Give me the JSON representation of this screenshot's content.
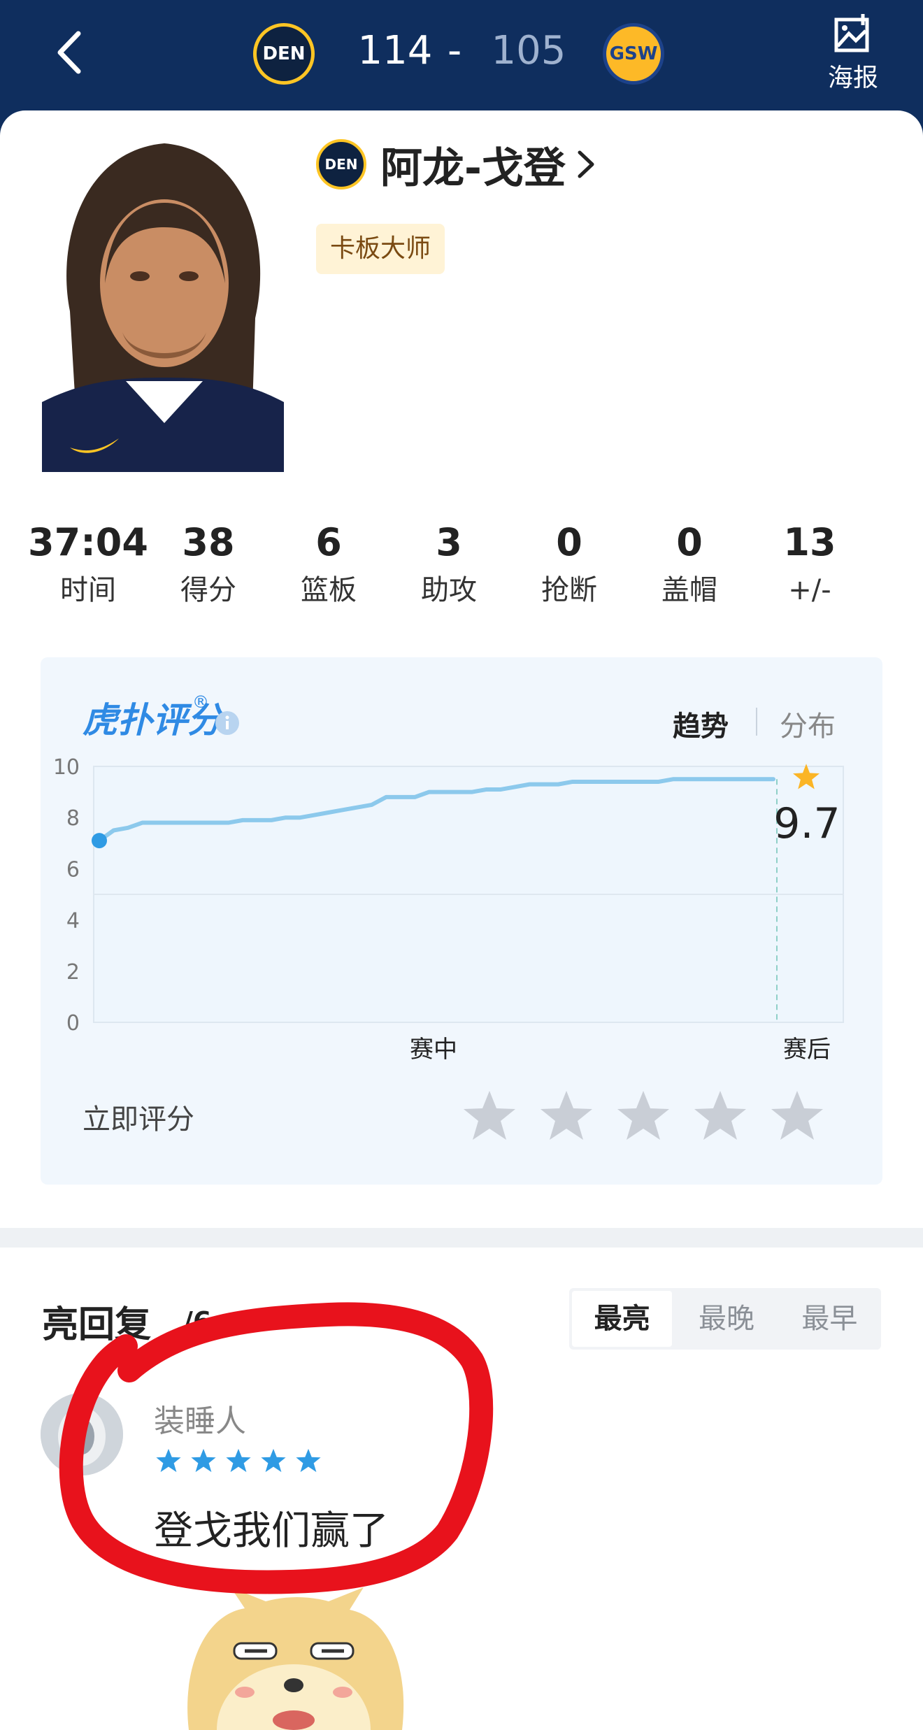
{
  "header": {
    "home_team_logo": "DEN",
    "away_team_logo": "GSW",
    "home_score": "114",
    "separator": "-",
    "away_score": "105",
    "poster_label": "海报",
    "colors": {
      "background": "#0f2e5e"
    }
  },
  "player": {
    "team_logo": "DEN",
    "name": "阿龙-戈登",
    "badge": "卡板大师"
  },
  "stats": [
    {
      "value": "37:04",
      "label": "时间"
    },
    {
      "value": "38",
      "label": "得分"
    },
    {
      "value": "6",
      "label": "篮板"
    },
    {
      "value": "3",
      "label": "助攻"
    },
    {
      "value": "0",
      "label": "抢断"
    },
    {
      "value": "0",
      "label": "盖帽"
    },
    {
      "value": "13",
      "label": "+/-"
    }
  ],
  "rating": {
    "brand": "虎扑评分",
    "brand_mark": "®",
    "tabs": {
      "trend": "趋势",
      "distribution": "分布"
    },
    "score": "9.7",
    "rate_label": "立即评分",
    "accent_color": "#2f8ae4"
  },
  "chart_data": {
    "type": "line",
    "title": "",
    "xlabel": "",
    "ylabel": "",
    "ylim": [
      0,
      10
    ],
    "y_ticks": [
      "0",
      "2",
      "4",
      "6",
      "8",
      "10"
    ],
    "x_labels": [
      "赛中",
      "赛后"
    ],
    "final_value": "9.7",
    "series": [
      {
        "values": [
          7.1,
          7.5,
          7.6,
          7.8,
          7.8,
          7.8,
          7.8,
          7.8,
          7.8,
          7.8,
          7.9,
          7.9,
          7.9,
          8.0,
          8.0,
          8.1,
          8.2,
          8.3,
          8.4,
          8.5,
          8.8,
          8.8,
          8.8,
          9.0,
          9.0,
          9.0,
          9.0,
          9.1,
          9.1,
          9.2,
          9.3,
          9.3,
          9.3,
          9.4,
          9.4,
          9.4,
          9.4,
          9.4,
          9.4,
          9.4,
          9.5,
          9.5,
          9.5,
          9.5,
          9.5,
          9.5,
          9.5,
          9.5
        ]
      }
    ]
  },
  "replies": {
    "title": "亮回复",
    "count": "/6",
    "sort_tabs": [
      "最亮",
      "最晚",
      "最早"
    ],
    "items": [
      {
        "user": "装睡人",
        "stars": 5,
        "text": "登戈我们赢了"
      }
    ]
  }
}
